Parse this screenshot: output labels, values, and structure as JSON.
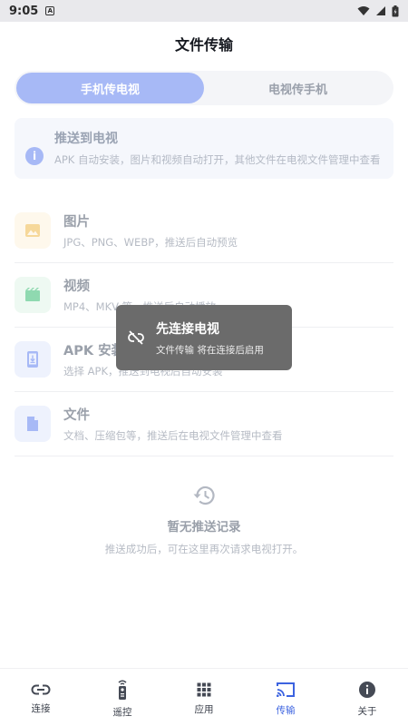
{
  "status_bar": {
    "time": "9:05",
    "badge": "A"
  },
  "header": {
    "title": "文件传输"
  },
  "segmented": [
    {
      "label": "手机传电视",
      "active": true
    },
    {
      "label": "电视传手机",
      "active": false
    }
  ],
  "info_card": {
    "icon": "info-icon",
    "title": "推送到电视",
    "description": "APK 自动安装，图片和视频自动打开，其他文件在电视文件管理中查看"
  },
  "file_types": [
    {
      "icon": "image-icon",
      "name": "图片",
      "desc": "JPG、PNG、WEBP，推送后自动预览",
      "color": "#f6d89a",
      "bg": "#fef8ec"
    },
    {
      "icon": "video-icon",
      "name": "视频",
      "desc": "MP4、MKV 等，推送后自动播放",
      "color": "#8fd9b0",
      "bg": "#eef9f2"
    },
    {
      "icon": "apk-icon",
      "name": "APK 安装",
      "desc": "选择 APK，推送到电视后自动安装",
      "color": "#a7b9f6",
      "bg": "#eef2fd"
    },
    {
      "icon": "file-icon",
      "name": "文件",
      "desc": "文档、压缩包等，推送后在电视文件管理中查看",
      "color": "#a7b9f6",
      "bg": "#eef2fd"
    }
  ],
  "empty_state": {
    "icon": "history-icon",
    "title": "暂无推送记录",
    "subtitle": "推送成功后，可在这里再次请求电视打开。"
  },
  "toast": {
    "icon": "link-off-icon",
    "title": "先连接电视",
    "message": "文件传输 将在连接后启用"
  },
  "bottom_nav": [
    {
      "icon": "link-icon",
      "label": "连接",
      "active": false
    },
    {
      "icon": "remote-icon",
      "label": "遥控",
      "active": false
    },
    {
      "icon": "apps-icon",
      "label": "应用",
      "active": false
    },
    {
      "icon": "cast-icon",
      "label": "传输",
      "active": true
    },
    {
      "icon": "about-icon",
      "label": "关于",
      "active": false
    }
  ],
  "colors": {
    "accent": "#3c63e0",
    "segment_active": "#a7b9f6"
  }
}
